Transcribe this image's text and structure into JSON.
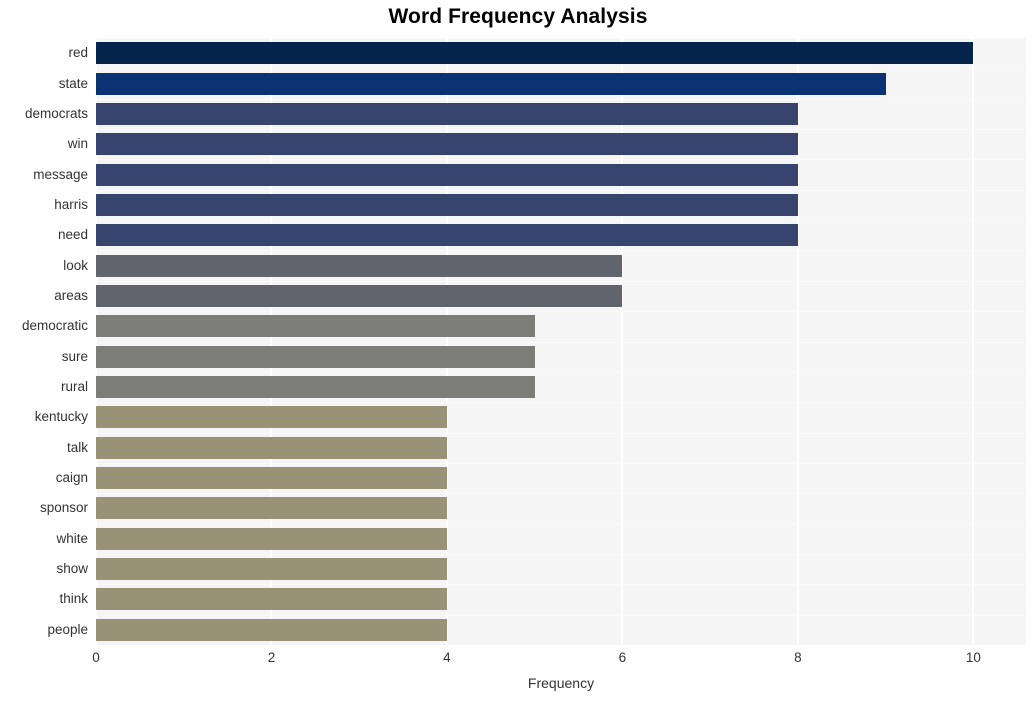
{
  "chart_data": {
    "type": "bar",
    "orientation": "horizontal",
    "title": "Word Frequency Analysis",
    "xlabel": "Frequency",
    "ylabel": "",
    "xlim": [
      0,
      10.6
    ],
    "xticks": [
      0,
      2,
      4,
      6,
      8,
      10
    ],
    "xtick_labels": [
      "0",
      "2",
      "4",
      "6",
      "8",
      "10"
    ],
    "grid": true,
    "legend": null,
    "categories": [
      "red",
      "state",
      "democrats",
      "win",
      "message",
      "harris",
      "need",
      "look",
      "areas",
      "democratic",
      "sure",
      "rural",
      "kentucky",
      "talk",
      "caign",
      "sponsor",
      "white",
      "show",
      "think",
      "people"
    ],
    "values": [
      10,
      9,
      8,
      8,
      8,
      8,
      8,
      6,
      6,
      5,
      5,
      5,
      4,
      4,
      4,
      4,
      4,
      4,
      4,
      4
    ],
    "bar_colors": [
      "#04244c",
      "#0b3272",
      "#36446e",
      "#36446e",
      "#36446e",
      "#36446e",
      "#36446e",
      "#62646d",
      "#62646d",
      "#7c7c78",
      "#7c7c78",
      "#7c7c78",
      "#9a9276",
      "#9a9276",
      "#9a9276",
      "#9a9276",
      "#9a9276",
      "#9a9276",
      "#9a9276",
      "#9a9276"
    ],
    "plot_background": "#f5f5f5",
    "gridline_color": "#ffffff",
    "page_background": "#ffffff"
  }
}
